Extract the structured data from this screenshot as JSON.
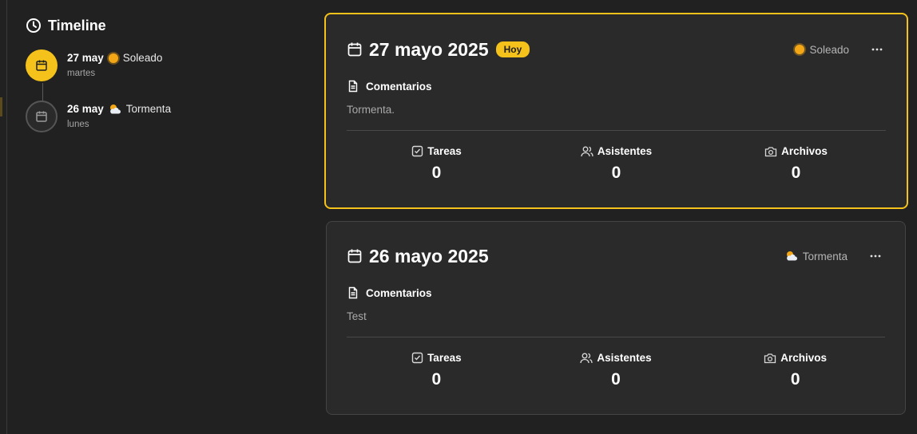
{
  "timeline": {
    "title": "Timeline",
    "items": [
      {
        "date": "27 may",
        "weather": "Soleado",
        "weather_icon": "sun-icon",
        "weekday": "martes",
        "active": true
      },
      {
        "date": "26 may",
        "weather": "Tormenta",
        "weather_icon": "sun-behind-cloud-icon",
        "weekday": "lunes",
        "active": false
      }
    ]
  },
  "cards": [
    {
      "title": "27 mayo 2025",
      "badge": "Hoy",
      "weather": "Soleado",
      "weather_icon": "sun-icon",
      "comments_label": "Comentarios",
      "comment": "Tormenta.",
      "stats": [
        {
          "label": "Tareas",
          "value": "0",
          "icon": "checkbox-icon"
        },
        {
          "label": "Asistentes",
          "value": "0",
          "icon": "users-icon"
        },
        {
          "label": "Archivos",
          "value": "0",
          "icon": "camera-icon"
        }
      ]
    },
    {
      "title": "26 mayo 2025",
      "weather": "Tormenta",
      "weather_icon": "sun-behind-cloud-icon",
      "comments_label": "Comentarios",
      "comment": "Test",
      "stats": [
        {
          "label": "Tareas",
          "value": "0",
          "icon": "checkbox-icon"
        },
        {
          "label": "Asistentes",
          "value": "0",
          "icon": "users-icon"
        },
        {
          "label": "Archivos",
          "value": "0",
          "icon": "camera-icon"
        }
      ]
    }
  ],
  "colors": {
    "accent": "#f5c21b",
    "background": "#212121",
    "card": "#2a2a2a"
  }
}
